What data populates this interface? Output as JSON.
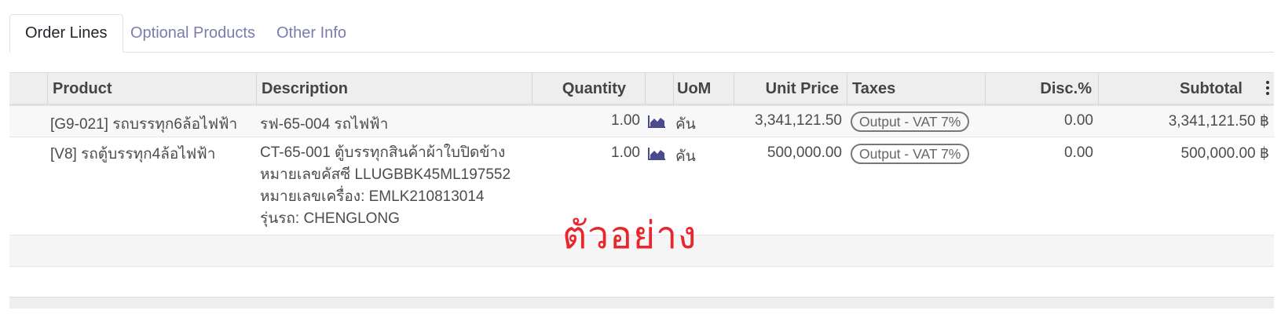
{
  "tabs": [
    {
      "label": "Order Lines",
      "active": true
    },
    {
      "label": "Optional Products",
      "active": false
    },
    {
      "label": "Other Info",
      "active": false
    }
  ],
  "table": {
    "headers": {
      "product": "Product",
      "description": "Description",
      "quantity": "Quantity",
      "uom": "UoM",
      "unit_price": "Unit Price",
      "taxes": "Taxes",
      "discount": "Disc.%",
      "subtotal": "Subtotal"
    },
    "rows": [
      {
        "product": "[G9-021] รถบรรทุก6ล้อไฟฟ้า",
        "description": [
          "รฟ-65-004 รถไฟฟ้า"
        ],
        "quantity": "1.00",
        "uom": "คัน",
        "unit_price": "3,341,121.50",
        "tax": "Output - VAT 7%",
        "discount": "0.00",
        "subtotal": "3,341,121.50 ฿"
      },
      {
        "product": "[V8] รถตู้บรรทุก4ล้อไฟฟ้า",
        "description": [
          "CT-65-001 ตู้บรรทุกสินค้าผ้าใบปิดข้าง",
          "หมายเลขคัสซี LLUGBBK45ML197552",
          "หมายเลขเครื่อง: EMLK210813014",
          "รุ่นรถ: CHENGLONG"
        ],
        "quantity": "1.00",
        "uom": "คัน",
        "unit_price": "500,000.00",
        "tax": "Output - VAT 7%",
        "discount": "0.00",
        "subtotal": "500,000.00 ฿"
      }
    ]
  },
  "icons": {
    "forecast": "area-chart-icon",
    "column_menu": "kebab-menu-icon"
  },
  "watermark": "ตัวอย่าง",
  "colors": {
    "link": "#7c7bad",
    "icon": "#4b4a8e",
    "watermark": "#e8262b",
    "header_bg": "#eeeeee"
  }
}
